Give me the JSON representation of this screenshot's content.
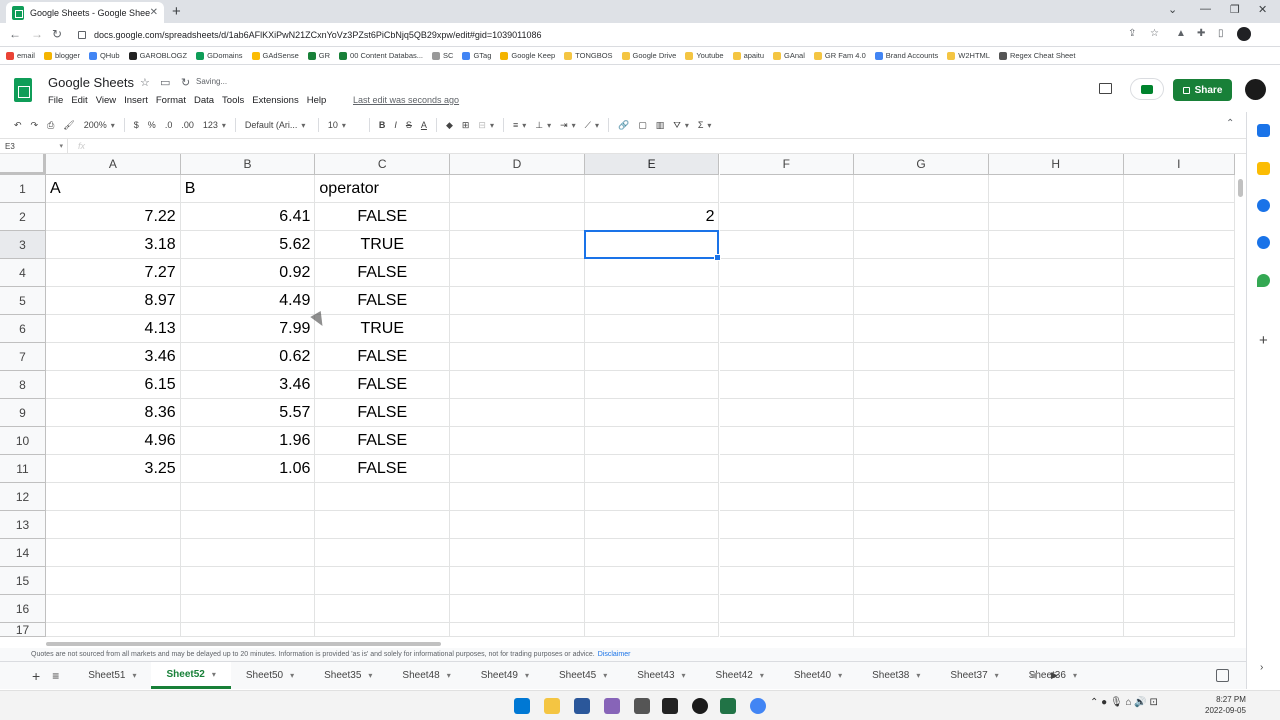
{
  "browser": {
    "tab_title": "Google Sheets - Google Sheets",
    "url": "docs.google.com/spreadsheets/d/1ab6AFlKXiPwN21ZCxnYoVz3PZst6PiCbNjq5QB29xpw/edit#gid=1039011086",
    "bookmarks": [
      "email",
      "blogger",
      "QHub",
      "GAROBLOGZ",
      "GDomains",
      "GAdSense",
      "GR",
      "00 Content Databas...",
      "SC",
      "GTag",
      "Google Keep",
      "TONGBOS",
      "Google Drive",
      "Youtube",
      "apaitu",
      "GAnal",
      "GR Fam 4.0",
      "Brand Accounts",
      "W2HTML",
      "Regex Cheat Sheet"
    ]
  },
  "header": {
    "doc_title": "Google Sheets",
    "saving_text": "Saving...",
    "menu": [
      "File",
      "Edit",
      "View",
      "Insert",
      "Format",
      "Data",
      "Tools",
      "Extensions",
      "Help"
    ],
    "last_edit": "Last edit was seconds ago",
    "share_label": "Share"
  },
  "toolbar": {
    "zoom": "200%",
    "currency": "$",
    "percent": "%",
    "dec_less": ".0",
    "dec_more": ".00",
    "more_formats": "123",
    "font": "Default (Ari...",
    "font_size": "10",
    "bold": "B",
    "italic": "I",
    "strike": "S",
    "text_color": "A",
    "sum": "Σ"
  },
  "formula_bar": {
    "name_box": "E3",
    "fx": "fx",
    "value": ""
  },
  "grid": {
    "columns": [
      "A",
      "B",
      "C",
      "D",
      "E",
      "F",
      "G",
      "H",
      "I"
    ],
    "active_column": "E",
    "rows": [
      "1",
      "2",
      "3",
      "4",
      "5",
      "6",
      "7",
      "8",
      "9",
      "10",
      "11",
      "12",
      "13",
      "14",
      "15",
      "16",
      "17"
    ],
    "active_row": "3",
    "cells": {
      "A": [
        "A",
        "7.22",
        "3.18",
        "7.27",
        "8.97",
        "4.13",
        "3.46",
        "6.15",
        "8.36",
        "4.96",
        "3.25"
      ],
      "B": [
        "B",
        "6.41",
        "5.62",
        "0.92",
        "4.49",
        "7.99",
        "0.62",
        "3.46",
        "5.57",
        "1.96",
        "1.06"
      ],
      "C": [
        "operator",
        "FALSE",
        "TRUE",
        "FALSE",
        "FALSE",
        "TRUE",
        "FALSE",
        "FALSE",
        "FALSE",
        "FALSE",
        "FALSE"
      ],
      "E2": "2"
    },
    "selected_cell": "E3"
  },
  "disclaimer": {
    "text": "Quotes are not sourced from all markets and may be delayed up to 20 minutes. Information is provided 'as is' and solely for informational purposes, not for trading purposes or advice.",
    "link": "Disclaimer"
  },
  "sheets": {
    "tabs": [
      "Sheet51",
      "Sheet52",
      "Sheet50",
      "Sheet35",
      "Sheet48",
      "Sheet49",
      "Sheet45",
      "Sheet43",
      "Sheet42",
      "Sheet40",
      "Sheet38",
      "Sheet37",
      "Sheet36"
    ],
    "active": "Sheet52"
  },
  "taskbar": {
    "time": "8:27 PM",
    "date": "2022-09-05"
  },
  "colors": {
    "sheets_green": "#188038",
    "selection_blue": "#1a73e8",
    "header_gray": "#f8f9fa"
  }
}
